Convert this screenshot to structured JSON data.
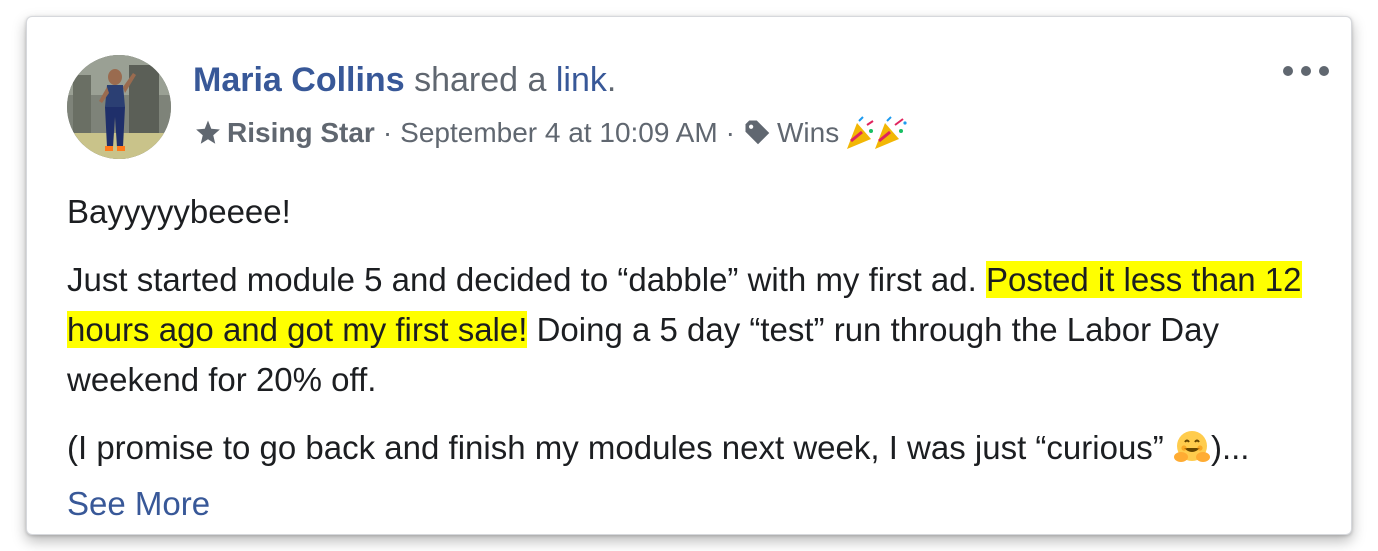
{
  "post": {
    "author_name": "Maria Collins",
    "action_text": "shared a",
    "link_label": "link",
    "period": ".",
    "badge_label": "Rising Star",
    "separator": "·",
    "timestamp": "September 4 at 10:09 AM",
    "topic_tag": "Wins",
    "paragraph_1": "Bayyyyybeeee!",
    "paragraph_2_before": "Just started module 5 and decided to “dabble” with my first ad. ",
    "paragraph_2_highlight": "Posted it less than 12 hours ago and got my first sale!",
    "paragraph_2_after": " Doing a 5 day “test” run through the Labor Day weekend for 20% off.",
    "paragraph_3_before": "(I promise to go back and finish my modules next week, I was just “curious” ",
    "paragraph_3_after": ")... ",
    "see_more_label": "See More"
  },
  "icons": {
    "options": "more-options-icon",
    "badge": "star-icon",
    "tag": "tag-icon",
    "celebration": "party-popper-icon",
    "hugging_face": "hugging-face-emoji"
  },
  "colors": {
    "link_blue": "#385898",
    "secondary_text": "#606770",
    "body_text": "#1c1e21",
    "highlight": "#ffff00"
  }
}
